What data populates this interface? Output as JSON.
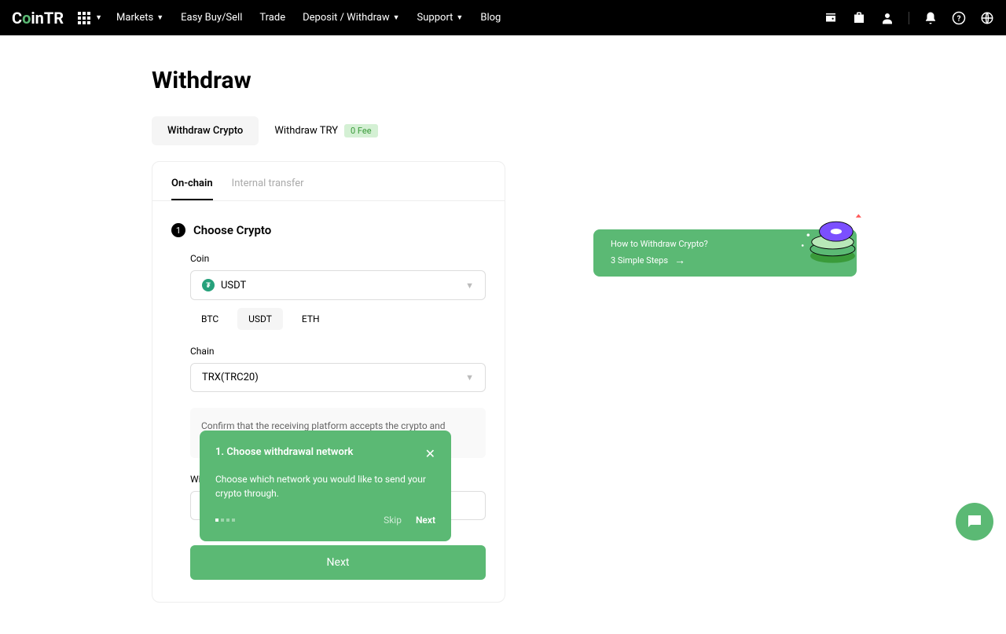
{
  "header": {
    "logo": "CoinTR",
    "nav": {
      "markets": "Markets",
      "easy": "Easy Buy/Sell",
      "trade": "Trade",
      "deposit": "Deposit / Withdraw",
      "support": "Support",
      "blog": "Blog"
    }
  },
  "page": {
    "title": "Withdraw",
    "tabs": {
      "crypto": "Withdraw Crypto",
      "try": "Withdraw TRY",
      "fee_badge": "0 Fee"
    },
    "sub_tabs": {
      "onchain": "On-chain",
      "internal": "Internal transfer"
    },
    "step1": {
      "num": "1",
      "title": "Choose Crypto",
      "coin_label": "Coin",
      "coin_value": "USDT",
      "quick": {
        "btc": "BTC",
        "usdt": "USDT",
        "eth": "ETH"
      },
      "chain_label": "Chain",
      "chain_value": "TRX(TRC20)",
      "warning": "Confirm that the receiving platform accepts the crypto and network",
      "withdraw_label": "Wi"
    },
    "next_button": "Next"
  },
  "tooltip": {
    "title": "1. Choose withdrawal network",
    "body": "Choose which network you would like to send your crypto through.",
    "skip": "Skip",
    "next": "Next"
  },
  "promo": {
    "title": "How to Withdraw Crypto?",
    "sub": "3 Simple Steps"
  }
}
